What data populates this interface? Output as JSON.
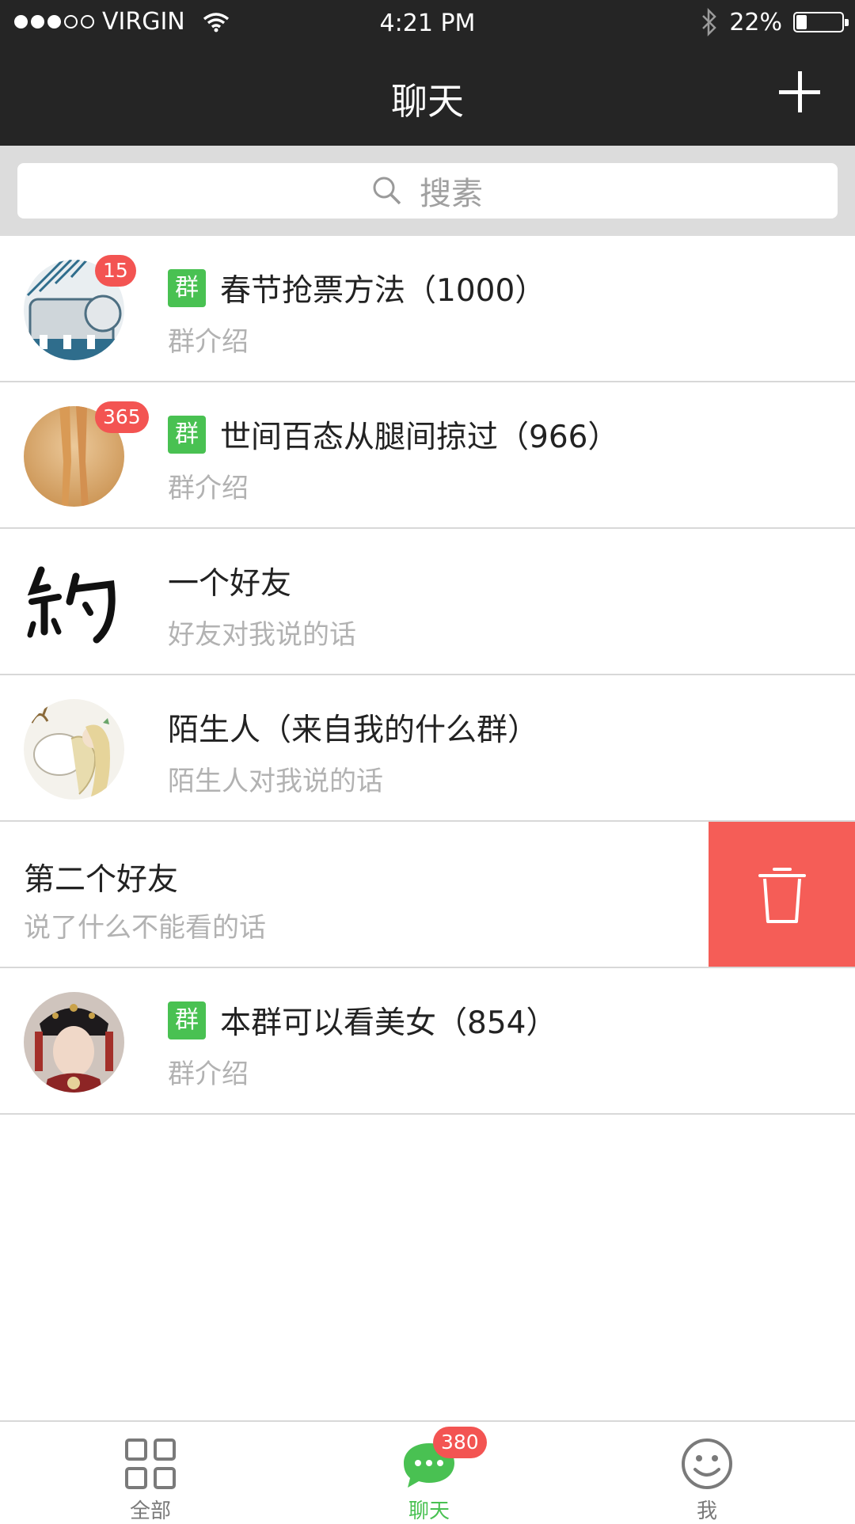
{
  "status_bar": {
    "carrier": "VIRGIN",
    "time": "4:21 PM",
    "battery": "22%",
    "battery_level": 0.22
  },
  "header": {
    "title": "聊天",
    "add_icon": "plus-icon"
  },
  "search": {
    "placeholder": "搜素",
    "icon": "search-icon"
  },
  "conversations": [
    {
      "is_group": true,
      "group_tag": "群",
      "title": "春节抢票方法（1000）",
      "subtitle": "群介绍",
      "unread": "15",
      "avatar": "train-illustration"
    },
    {
      "is_group": true,
      "group_tag": "群",
      "title": "世间百态从腿间掠过（966）",
      "subtitle": "群介绍",
      "unread": "365",
      "avatar": "legs-photo"
    },
    {
      "is_group": false,
      "title": "一个好友",
      "subtitle": "好友对我说的话",
      "avatar": "calligraphy-yue"
    },
    {
      "is_group": false,
      "title": "陌生人（来自我的什么群）",
      "subtitle": "陌生人对我说的话",
      "avatar": "girl-deer-illustration"
    },
    {
      "is_group": false,
      "title": "第二个好友",
      "subtitle": "说了什么不能看的话",
      "swiped": true,
      "action_icon": "trash-icon"
    },
    {
      "is_group": true,
      "group_tag": "群",
      "title": "本群可以看美女（854）",
      "subtitle": "群介绍",
      "avatar": "costume-portrait"
    }
  ],
  "tabbar": {
    "items": [
      {
        "label": "全部",
        "icon": "grid-icon",
        "active": false
      },
      {
        "label": "聊天",
        "icon": "chat-bubble-icon",
        "active": true,
        "badge": "380"
      },
      {
        "label": "我",
        "icon": "smiley-icon",
        "active": false
      }
    ]
  },
  "colors": {
    "header_bg": "#252525",
    "accent_green": "#49c152",
    "badge_red": "#f35452",
    "delete_red": "#f55d57"
  }
}
